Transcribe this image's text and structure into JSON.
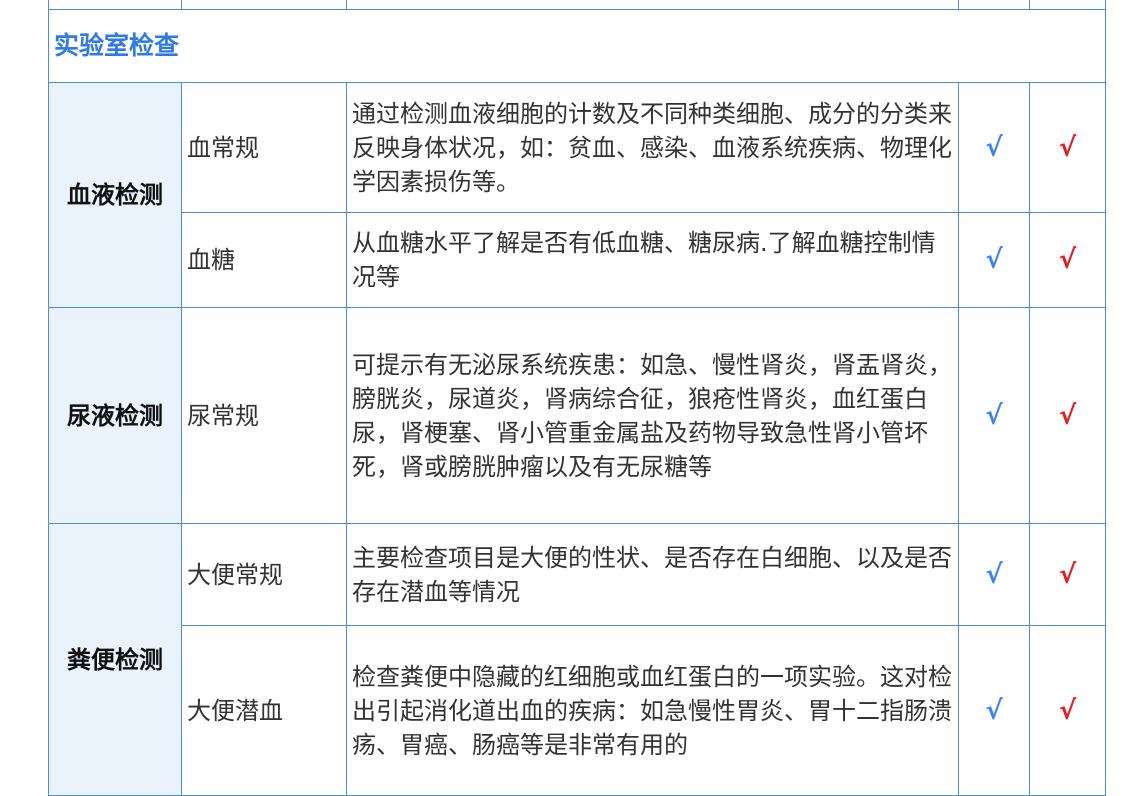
{
  "colors": {
    "border": "#4a90d9",
    "category_bg": "#eaf2fb",
    "section_text": "#2f7ae5",
    "check_a": "#3b82f6",
    "check_b": "#e0201c"
  },
  "section": {
    "title": "实验室检查"
  },
  "groups": [
    {
      "category": "血液检测",
      "rows": [
        {
          "item": "血常规",
          "desc": "通过检测血液细胞的计数及不同种类细胞、成分的分类来反映身体状况，如：贫血、感染、血液系统疾病、物理化学因素损伤等。",
          "check_a": "√",
          "check_b": "√"
        },
        {
          "item": "血糖",
          "desc": "从血糖水平了解是否有低血糖、糖尿病.了解血糖控制情况等",
          "check_a": "√",
          "check_b": "√"
        }
      ]
    },
    {
      "category": "尿液检测",
      "rows": [
        {
          "item": "尿常规",
          "desc": "可提示有无泌尿系统疾患：如急、慢性肾炎，肾盂肾炎，膀胱炎，尿道炎，肾病综合征，狼疮性肾炎，血红蛋白尿，肾梗塞、肾小管重金属盐及药物导致急性肾小管坏死，肾或膀胱肿瘤以及有无尿糖等",
          "check_a": "√",
          "check_b": "√"
        }
      ]
    },
    {
      "category": "粪便检测",
      "rows": [
        {
          "item": "大便常规",
          "desc": "主要检查项目是大便的性状、是否存在白细胞、以及是否存在潜血等情况",
          "check_a": "√",
          "check_b": "√"
        },
        {
          "item": "大便潜血",
          "desc": "检查粪便中隐藏的红细胞或血红蛋白的一项实验。这对检出引起消化道出血的疾病：如急慢性胃炎、胃十二指肠溃疡、胃癌、肠癌等是非常有用的",
          "check_a": "√",
          "check_b": "√"
        }
      ]
    }
  ]
}
